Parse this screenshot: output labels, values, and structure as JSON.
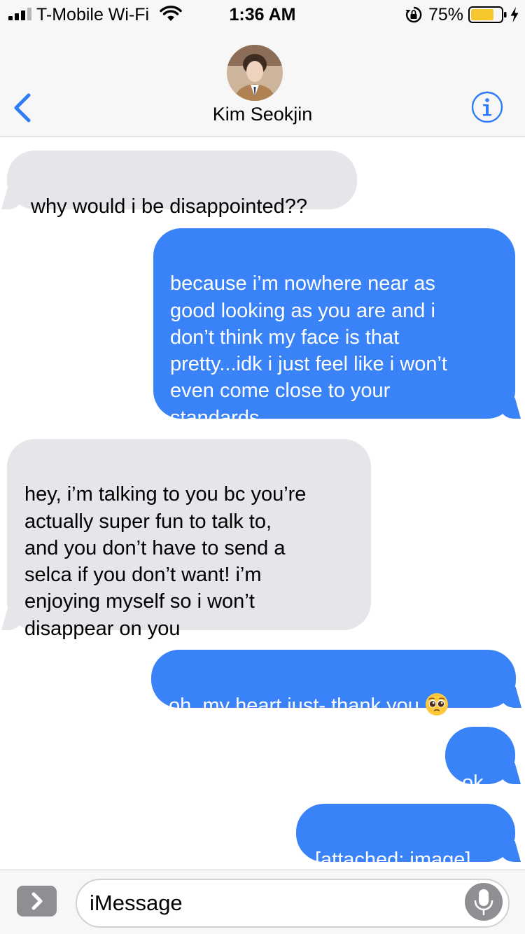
{
  "status_bar": {
    "carrier": "T-Mobile Wi-Fi",
    "time": "1:36 AM",
    "battery_percent": "75%",
    "battery_level": 0.75,
    "signal_bars": 3,
    "signal_bars_total": 4,
    "icons": [
      "signal-icon",
      "wifi-icon",
      "orientation-lock-icon",
      "battery-icon",
      "charging-icon"
    ]
  },
  "header": {
    "contact_name": "Kim Seokjin",
    "icons": [
      "chevron-left-icon",
      "avatar",
      "info-icon"
    ]
  },
  "messages": [
    {
      "direction": "received",
      "text": "why would i be disappointed??"
    },
    {
      "direction": "sent",
      "text": "because i’m nowhere near as\ngood looking as you are and i\ndon’t think my face is that\npretty...idk i just feel like i won’t\neven come close to your\nstandards"
    },
    {
      "direction": "received",
      "text": "hey, i’m talking to you bc you’re\nactually super fun to talk to,\nand you don’t have to send a\nselca if you don’t want! i’m\nenjoying myself so i won’t\ndisappear on you"
    },
    {
      "direction": "sent",
      "text": "oh..my heart just- thank you",
      "emoji": "pleading-face"
    },
    {
      "direction": "sent",
      "text": "ok."
    },
    {
      "direction": "sent",
      "text": "[attached: image]"
    }
  ],
  "input_bar": {
    "placeholder": "iMessage",
    "icons": [
      "chevron-right-icon",
      "microphone-icon"
    ]
  },
  "colors": {
    "sent_bubble": "#3a82f7",
    "received_bubble": "#e5e5ea",
    "accent": "#2f7cf6",
    "bar_background": "#f7f7f7"
  }
}
